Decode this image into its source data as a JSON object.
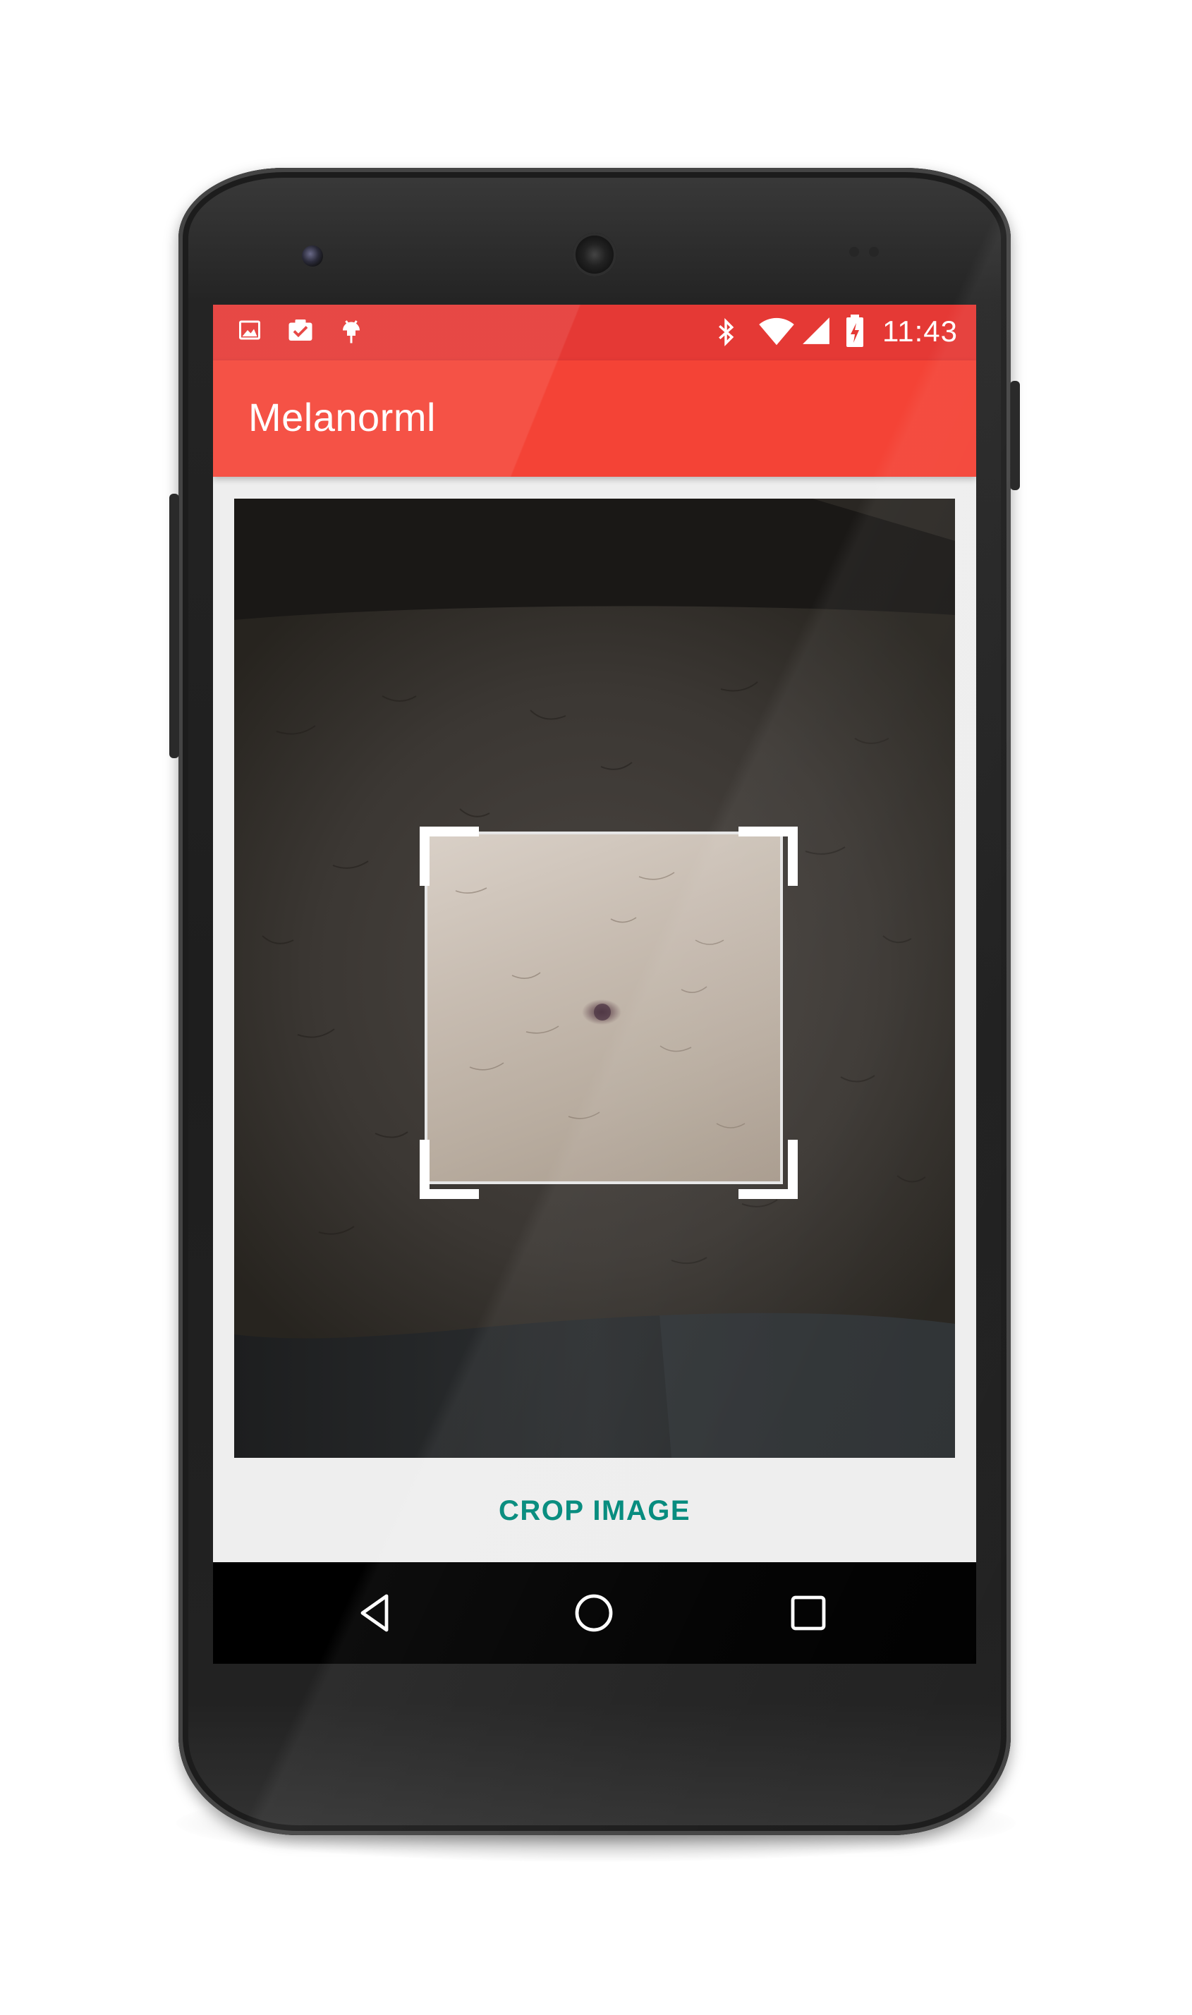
{
  "status_bar": {
    "time": "11:43",
    "background_color": "#e53935",
    "left_icons": [
      "image-icon",
      "clipboard-check-icon",
      "android-debug-icon"
    ],
    "right_icons": [
      "bluetooth-icon",
      "wifi-icon",
      "cell-signal-icon",
      "battery-charging-icon"
    ]
  },
  "app_bar": {
    "title": "Melanorml",
    "background_color": "#f44336"
  },
  "crop_view": {
    "handles": [
      "top-left",
      "top-right",
      "bottom-left",
      "bottom-right"
    ]
  },
  "actions": {
    "crop_label": "CROP IMAGE",
    "crop_label_color": "#00897b"
  },
  "nav_bar": {
    "buttons": [
      "back-icon",
      "home-icon",
      "recents-icon"
    ]
  }
}
